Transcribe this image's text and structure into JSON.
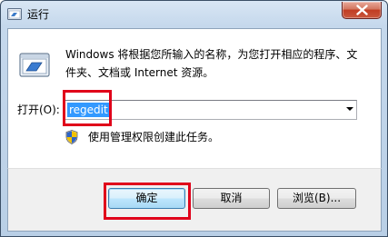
{
  "window": {
    "title": "运行"
  },
  "description": "Windows 将根据您所输入的名称，为您打开相应的程序、文件夹、文档或 Internet 资源。",
  "open_field": {
    "label": "打开(O):",
    "value": "regedit"
  },
  "admin_note": "使用管理权限创建此任务。",
  "buttons": {
    "ok": "确定",
    "cancel": "取消",
    "browse": "浏览(B)..."
  },
  "icons": {
    "title": "run-icon",
    "main": "run-dialog-icon",
    "shield": "uac-shield-icon",
    "close": "close-icon",
    "dropdown": "chevron-down-icon"
  },
  "colors": {
    "highlight_box": "#e0001a",
    "selection": "#3399ff"
  }
}
